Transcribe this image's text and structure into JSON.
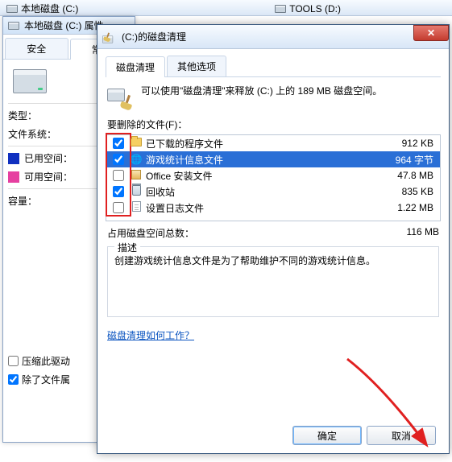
{
  "topbar": {
    "left_drive": "本地磁盘 (C:)",
    "right_drive": "TOOLS (D:)"
  },
  "prop": {
    "title": "本地磁盘 (C:) 属性",
    "tabs": {
      "security": "安全",
      "general": "常规"
    },
    "type_label": "类型：",
    "fs_label": "文件系统：",
    "used_label": "已用空间：",
    "free_label": "可用空间：",
    "capacity_label": "容量：",
    "chk_compress": "压缩此驱动",
    "chk_index": "除了文件属"
  },
  "dc": {
    "title": "(C:)的磁盘清理",
    "tabs": {
      "cleanup": "磁盘清理",
      "other": "其他选项"
    },
    "intro": "可以使用\"磁盘清理\"来释放  (C:) 上的 189 MB 磁盘空间。",
    "files_label": "要删除的文件(F)：",
    "rows": [
      {
        "checked": true,
        "icon": "folder",
        "name": "已下载的程序文件",
        "size": "912 KB",
        "sel": false
      },
      {
        "checked": true,
        "icon": "globe",
        "name": "游戏统计信息文件",
        "size": "964 字节",
        "sel": true
      },
      {
        "checked": false,
        "icon": "box",
        "name": "Office 安装文件",
        "size": "47.8 MB",
        "sel": false
      },
      {
        "checked": true,
        "icon": "bin",
        "name": "回收站",
        "size": "835 KB",
        "sel": false
      },
      {
        "checked": false,
        "icon": "doc",
        "name": "设置日志文件",
        "size": "1.22 MB",
        "sel": false
      }
    ],
    "total_label": "占用磁盘空间总数：",
    "total_value": "116 MB",
    "group_legend": "描述",
    "description": "创建游戏统计信息文件是为了帮助维护不同的游戏统计信息。",
    "link": "磁盘清理如何工作？",
    "ok": "确定",
    "cancel": "取消"
  }
}
